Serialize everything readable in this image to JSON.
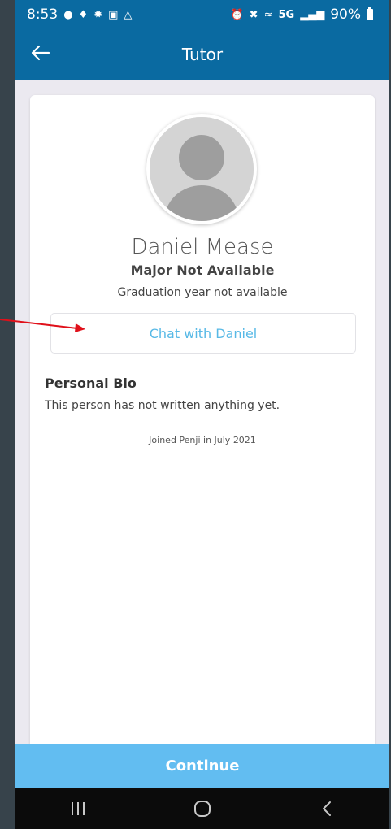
{
  "status_bar": {
    "time": "8:53",
    "network": "5G",
    "battery": "90%"
  },
  "app_bar": {
    "title": "Tutor"
  },
  "profile": {
    "name": "Daniel Mease",
    "major": "Major Not Available",
    "graduation": "Graduation year not available",
    "chat_label": "Chat with Daniel",
    "bio_title": "Personal Bio",
    "bio_text": "This person has not written anything yet.",
    "joined": "Joined Penji in July 2021"
  },
  "footer": {
    "continue_label": "Continue"
  },
  "colors": {
    "header": "#0a6aa1",
    "accent": "#58b9e6",
    "continue": "#62bdf1",
    "annotation_arrow": "#e0101a"
  },
  "icons": {
    "back": "arrow-left-icon",
    "recents": "recent-apps-icon",
    "home": "home-icon",
    "nav_back": "chevron-left-icon"
  }
}
